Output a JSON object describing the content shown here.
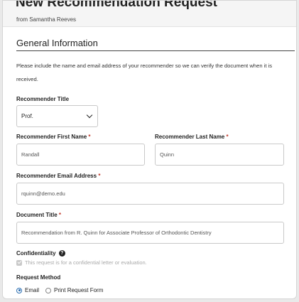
{
  "header": {
    "title": "New Recommendation Request",
    "subtitle": "from Samantha Reeves"
  },
  "section": {
    "title": "General Information",
    "intro": "Please include the name and email address of your recommender so we can verify the document when it is received."
  },
  "form": {
    "recommender_title": {
      "label": "Recommender Title",
      "value": "Prof."
    },
    "first_name": {
      "label": "Recommender First Name",
      "required_mark": "*",
      "value": "Randall"
    },
    "last_name": {
      "label": "Recommender Last Name",
      "required_mark": "*",
      "value": "Quinn"
    },
    "email": {
      "label": "Recommender Email Address",
      "required_mark": "*",
      "value": "rquinn@demo.edu"
    },
    "document_title": {
      "label": "Document Title",
      "required_mark": "*",
      "value": "Recommendation from R. Quinn for Associate Professor of Orthodontic Dentistry"
    },
    "confidentiality": {
      "label": "Confidentiality",
      "help_icon": "?",
      "checkbox_label": "This request is for a confidential letter or evaluation.",
      "checked": true,
      "disabled": true
    },
    "request_method": {
      "label": "Request Method",
      "options": [
        "Email",
        "Print Request Form"
      ],
      "selected": "Email"
    }
  },
  "colors": {
    "required": "#c0392b",
    "radio_accent": "#2a6db0",
    "header_bg": "#f5f5f5"
  }
}
